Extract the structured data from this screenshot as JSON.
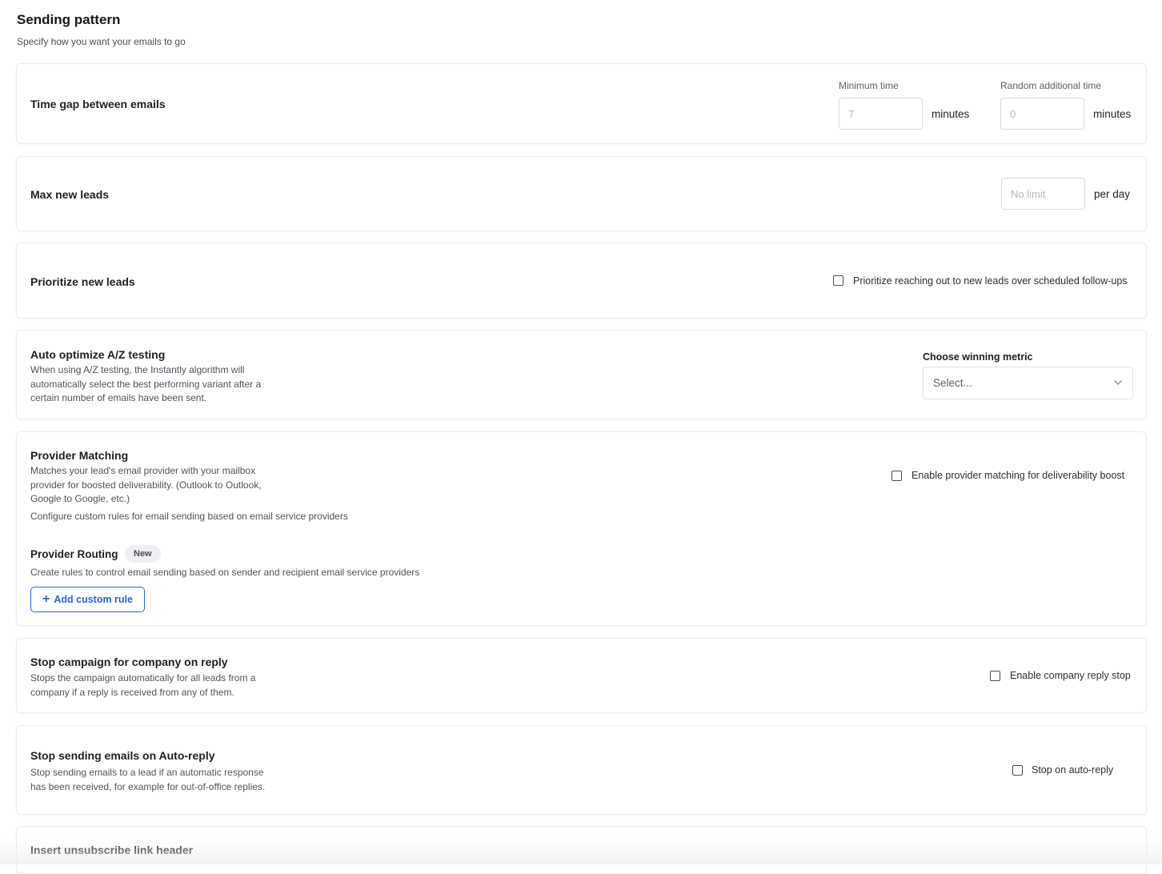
{
  "header": {
    "title": "Sending pattern",
    "subtitle": "Specify how you want your emails to go"
  },
  "time_gap": {
    "title": "Time gap between emails",
    "minimum_label": "Minimum time",
    "minimum_placeholder": "7",
    "minimum_unit": "minutes",
    "random_label": "Random additional time",
    "random_placeholder": "0",
    "random_unit": "minutes"
  },
  "max_leads": {
    "title": "Max new leads",
    "placeholder": "No limit",
    "unit": "per day"
  },
  "prioritize": {
    "title": "Prioritize new leads",
    "checkbox_label": "Prioritize reaching out to new leads over scheduled follow-ups",
    "checked": false
  },
  "az_testing": {
    "title": "Auto optimize A/Z testing",
    "description_lines": [
      "When using A/Z testing, the Instantly algorithm will",
      "automatically select the best performing variant after a",
      "certain number of emails have been sent."
    ],
    "metric_label": "Choose winning metric",
    "select_placeholder": "Select..."
  },
  "provider": {
    "title": "Provider Matching",
    "description_lines": [
      "Matches your lead's email provider with your mailbox",
      "provider for boosted deliverability. (Outlook to Outlook,",
      "Google to Google, etc.)"
    ],
    "configure_text": "Configure custom rules for email sending based on email service providers",
    "checkbox_label": "Enable provider matching for deliverability boost",
    "checked": false,
    "routing_title": "Provider Routing",
    "routing_badge": "New",
    "routing_desc": "Create rules to control email sending based on sender and recipient email service providers",
    "add_rule_label": "Add custom rule"
  },
  "company_stop": {
    "title": "Stop campaign for company on reply",
    "description_lines": [
      "Stops the campaign automatically for all leads from a",
      "company if a reply is received from any of them."
    ],
    "checkbox_label": "Enable company reply stop",
    "checked": false
  },
  "auto_reply": {
    "title": "Stop sending emails on Auto-reply",
    "description_lines": [
      "Stop sending emails to a lead if an automatic response",
      "has been received, for example for out-of-office replies."
    ],
    "checkbox_label": "Stop on auto-reply",
    "checked": false
  },
  "unsubscribe": {
    "title": "Insert unsubscribe link header"
  },
  "colors": {
    "accent": "#2563eb",
    "border": "#ececef",
    "text": "#1f2227"
  },
  "icons": {
    "chevron": "chevron-down-icon",
    "plus": "plus-icon"
  }
}
